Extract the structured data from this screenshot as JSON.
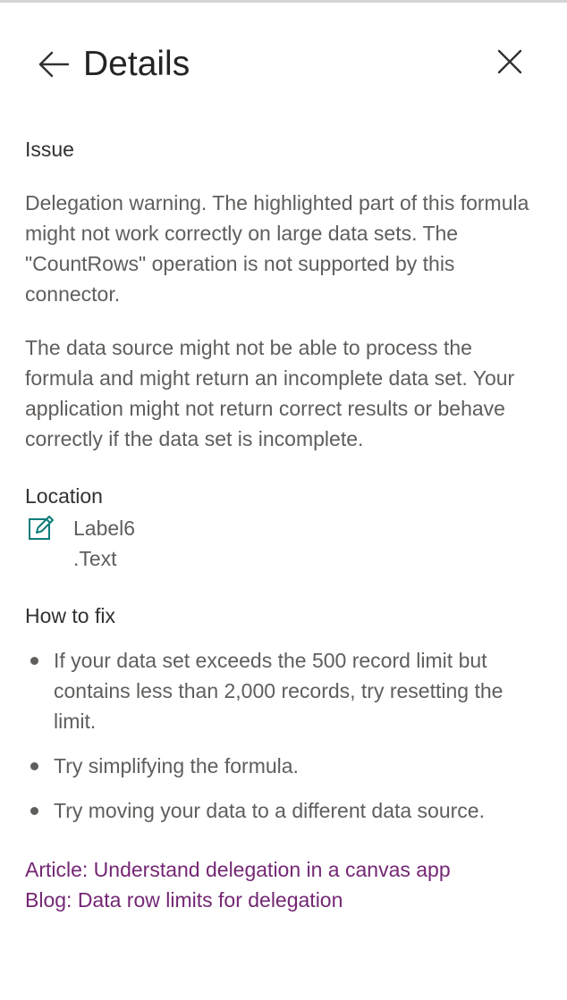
{
  "panel": {
    "title": "Details"
  },
  "issue": {
    "label": "Issue",
    "paragraphs": [
      "Delegation warning. The highlighted part of this formula might not work correctly on large data sets. The \"CountRows\" operation is not supported by this connector.",
      "The data source might not be able to process the formula and might return an incomplete data set. Your application might not return correct results or behave correctly if the data set is incomplete."
    ]
  },
  "location": {
    "label": "Location",
    "control": "Label6",
    "property": ".Text",
    "icon": "edit-icon"
  },
  "how_to_fix": {
    "label": "How to fix",
    "items": [
      "If your data set exceeds the 500 record limit but contains less than 2,000 records, try resetting the limit.",
      "Try simplifying the formula.",
      "Try moving your data to a different data source."
    ]
  },
  "links": [
    "Article: Understand delegation in a canvas app",
    "Blog: Data row limits for delegation"
  ],
  "colors": {
    "link": "#742774",
    "body_text": "#605e5c",
    "heading_text": "#323130",
    "icon_accent": "#0e7c7b"
  }
}
